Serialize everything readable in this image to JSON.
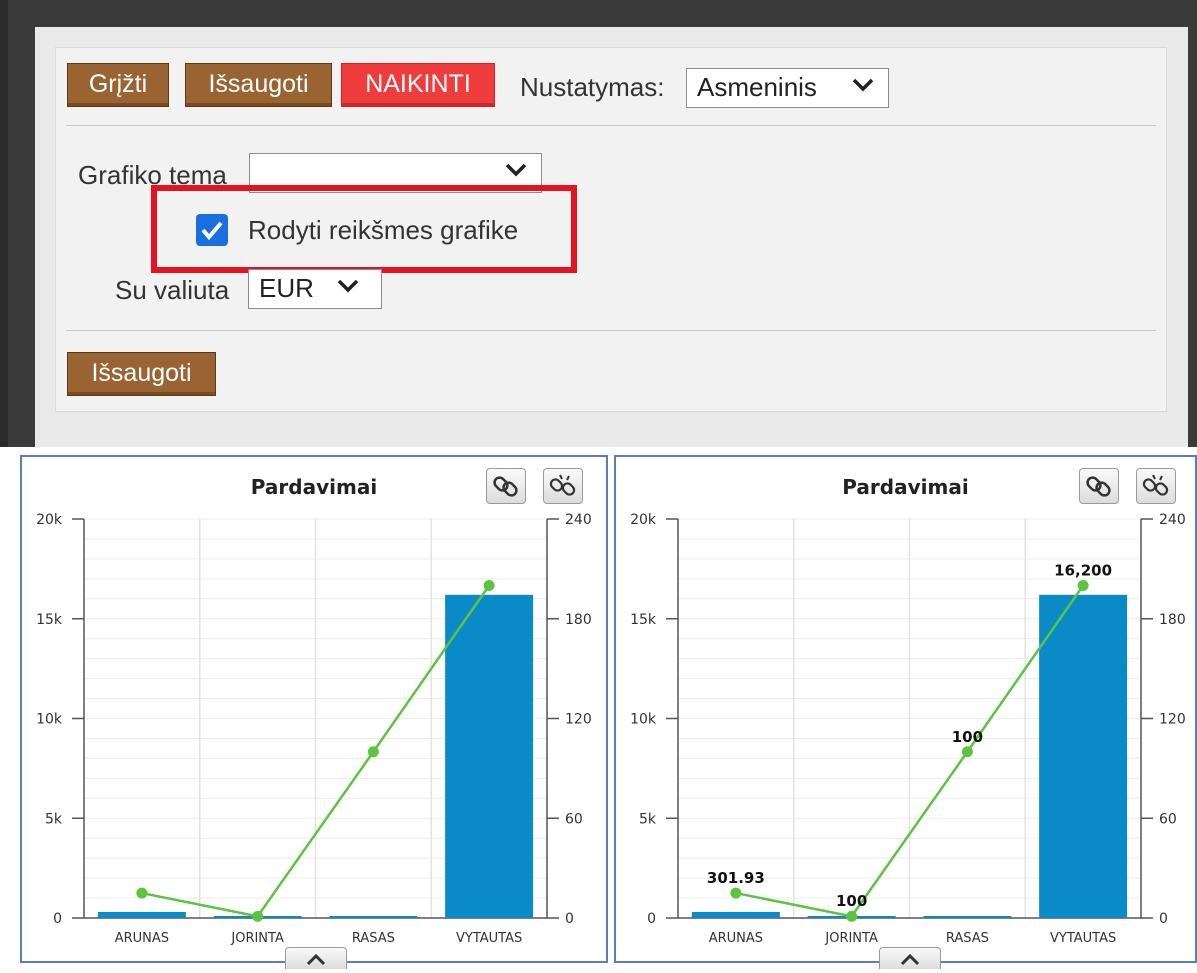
{
  "toolbar": {
    "back_label": "Grįžti",
    "save_label": "Išsaugoti",
    "delete_label": "NAIKINTI",
    "setting_label": "Nustatymas:",
    "setting_value": "Asmeninis"
  },
  "form": {
    "theme_label": "Grafiko tema",
    "theme_value": "",
    "show_values_label": "Rodyti reikšmes grafike",
    "show_values_checked": true,
    "currency_label": "Su valiuta",
    "currency_value": "EUR",
    "save_label": "Išsaugoti"
  },
  "colors": {
    "bar": "#0b8ac8",
    "line": "#5cc441",
    "delete_button": "#ef3c3c",
    "button": "#9a6432",
    "highlight": "#e2141f"
  },
  "chart_data": [
    {
      "type": "bar",
      "title": "Pardavimai",
      "categories": [
        "ARUNAS",
        "JORINTA",
        "RASAS",
        "VYTAUTAS"
      ],
      "series": [
        {
          "axis": "left",
          "kind": "bar",
          "values": [
            301.93,
            100,
            100,
            16200
          ]
        },
        {
          "axis": "right",
          "kind": "line",
          "values": [
            15,
            1,
            100,
            200
          ]
        }
      ],
      "ylim_left": [
        0,
        20000
      ],
      "ylim_right": [
        0,
        240
      ],
      "yticks_left": [
        "0",
        "5k",
        "10k",
        "15k",
        "20k"
      ],
      "yticks_right": [
        "0",
        "60",
        "120",
        "180",
        "240"
      ],
      "show_values": false,
      "value_labels": []
    },
    {
      "type": "bar",
      "title": "Pardavimai",
      "categories": [
        "ARUNAS",
        "JORINTA",
        "RASAS",
        "VYTAUTAS"
      ],
      "series": [
        {
          "axis": "left",
          "kind": "bar",
          "values": [
            301.93,
            100,
            100,
            16200
          ]
        },
        {
          "axis": "right",
          "kind": "line",
          "values": [
            15,
            1,
            100,
            200
          ]
        }
      ],
      "ylim_left": [
        0,
        20000
      ],
      "ylim_right": [
        0,
        240
      ],
      "yticks_left": [
        "0",
        "5k",
        "10k",
        "15k",
        "20k"
      ],
      "yticks_right": [
        "0",
        "60",
        "120",
        "180",
        "240"
      ],
      "show_values": true,
      "value_labels": [
        "301.93",
        "100",
        "100",
        "16,200"
      ]
    }
  ]
}
